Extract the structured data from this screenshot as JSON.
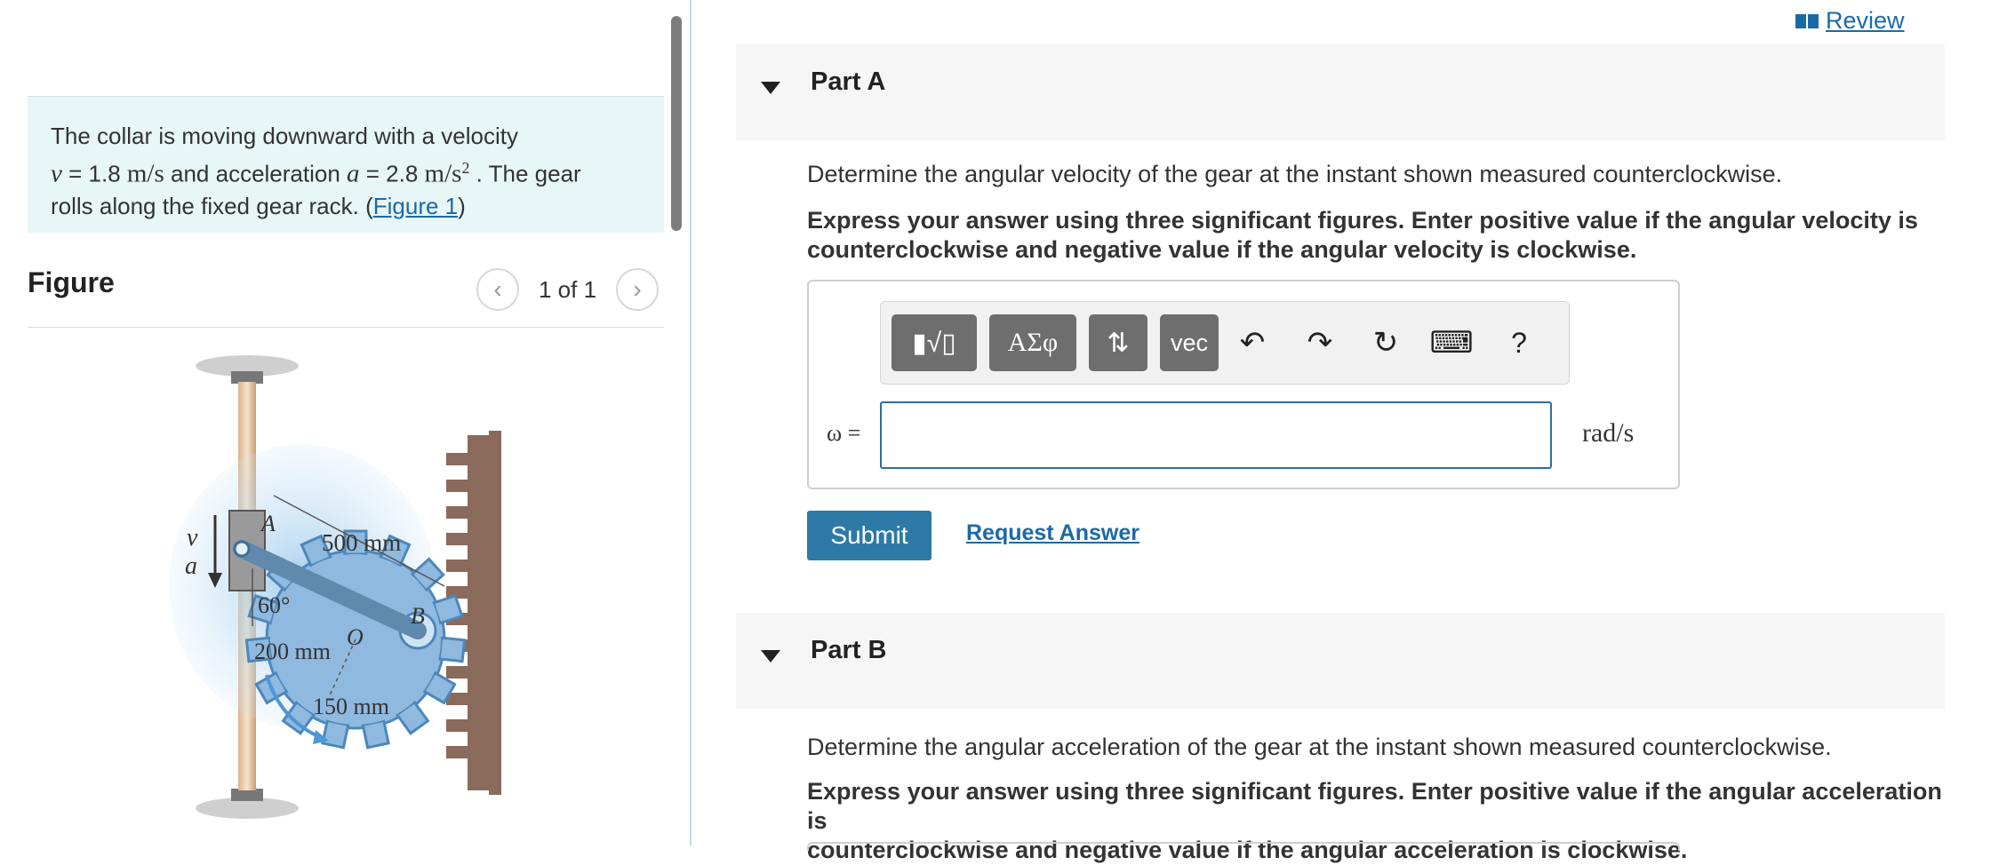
{
  "problem": {
    "line1": "The collar is moving downward with a velocity",
    "v_sym": "v",
    "v_eq": " = 1.8 ",
    "v_unit": "m/s",
    "and_acc": " and acceleration ",
    "a_sym": "a",
    "a_eq": " = 2.8 ",
    "a_unit": "m/s",
    "a_exp": "2",
    "after_acc": " . The gear",
    "line3": "rolls along the fixed gear rack. (",
    "figure_link": "Figure 1",
    "close_paren": ")"
  },
  "figure": {
    "title": "Figure",
    "pager_text": "1 of 1",
    "prev_glyph": "‹",
    "next_glyph": "›",
    "labels": {
      "v": "v",
      "a": "a",
      "A": "A",
      "B": "B",
      "O": "O",
      "len_500": "500 mm",
      "angle": "60°",
      "len_200": "200 mm",
      "len_150": "150 mm"
    }
  },
  "review_label": "Review",
  "partA": {
    "title": "Part A",
    "question": "Determine the angular velocity of the gear at the instant shown measured counterclockwise.",
    "instruction_l1": "Express your answer using three significant figures. Enter positive value if the angular velocity is",
    "instruction_l2": "counterclockwise and negative value if the angular velocity is clockwise.",
    "toolbar": {
      "templates": "▮√▯",
      "greek": "ΑΣφ",
      "arrows": "⇅",
      "vec": "vec",
      "undo": "↶",
      "redo": "↷",
      "reset": "↻",
      "keyboard": "⌨",
      "help": "?"
    },
    "answer_label": "ω =",
    "answer_value": "",
    "unit": "rad/s",
    "submit_label": "Submit",
    "request_label": "Request Answer"
  },
  "partB": {
    "title": "Part B",
    "question": "Determine the angular acceleration of the gear at the instant shown measured counterclockwise.",
    "instruction_l1": "Express your answer using three significant figures. Enter positive value if the angular acceleration is",
    "instruction_l2": "counterclockwise and negative value if the angular acceleration is clockwise."
  },
  "colors": {
    "problem_bg": "#e7f6f6",
    "link": "#1a6aa8",
    "submit_bg": "#2d7aa6",
    "input_border": "#2d6f9a",
    "toolbar_btn": "#6e6e6e"
  }
}
